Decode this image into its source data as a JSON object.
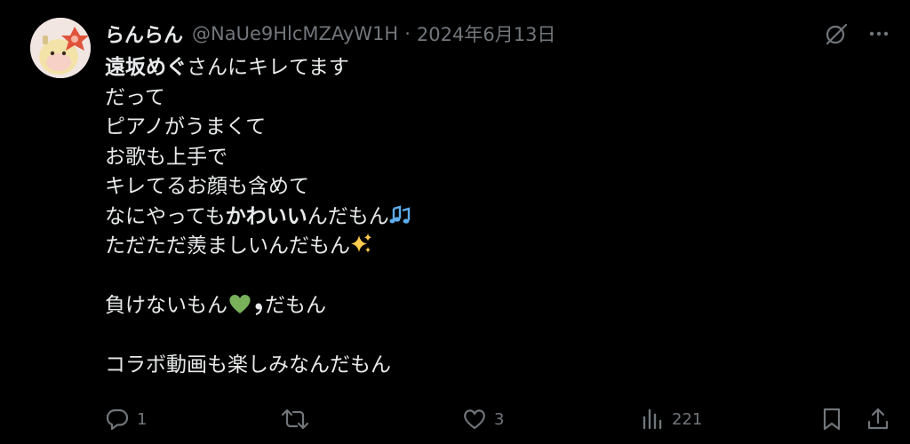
{
  "author": {
    "display_name": "らんらん",
    "handle": "@NaUe9HlcMZAyW1H",
    "separator": "·",
    "date": "2024年6月13日"
  },
  "tweet": {
    "line1_bold": "遠坂めぐ",
    "line1_rest": "さんにキレてます",
    "line2": "だって",
    "line3": "ピアノがうまくて",
    "line4": "お歌も上手で",
    "line5": "キレてるお顔も含めて",
    "line6_pre": "なにやっても",
    "line6_bold": "かわいい",
    "line6_post": "んだもん",
    "line7": "ただただ羨ましいんだもん",
    "line8_pre": "負けないもん",
    "line8_post": "だもん",
    "line9": "コラボ動画も楽しみなんだもん"
  },
  "stats": {
    "replies": "1",
    "retweets": "",
    "likes": "3",
    "views": "221"
  },
  "icons": {
    "more": "more-icon",
    "grok": "grok-icon",
    "reply": "reply-icon",
    "retweet": "retweet-icon",
    "like": "heart-icon",
    "views": "views-icon",
    "bookmark": "bookmark-icon",
    "share": "share-icon"
  },
  "colors": {
    "background": "#000000",
    "text": "#e7e9ea",
    "muted": "#71767b",
    "green_heart": "#78b159",
    "sparkle": "#ffcc4d",
    "notes": "#5dadec"
  }
}
